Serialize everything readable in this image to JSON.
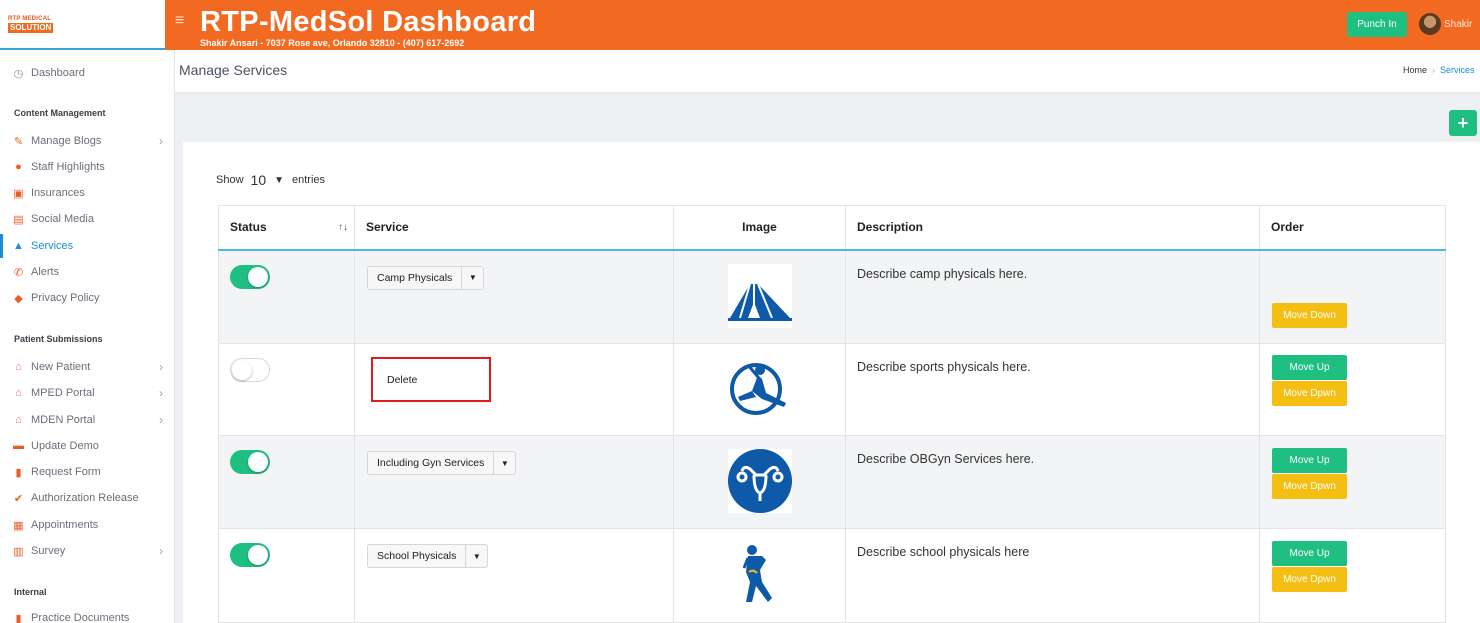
{
  "brand": {
    "logo_line1": "RTP MEDICAL",
    "logo_line2": "SOLUTION"
  },
  "header": {
    "title": "RTP-MedSol Dashboard",
    "subtitle": "Shakir Ansari - 7037 Rose ave, Orlando 32810 - (407) 617-2692",
    "punch_label": "Punch In",
    "user_name": "Shakir"
  },
  "sidebar": {
    "dashboard": "Dashboard",
    "sections": [
      "Content Management",
      "Patient Submissions",
      "Internal"
    ],
    "content_items": [
      {
        "label": "Manage Blogs",
        "icon": "blog-icon"
      },
      {
        "label": "Staff Highlights",
        "icon": "user-icon"
      },
      {
        "label": "Insurances",
        "icon": "building-icon"
      },
      {
        "label": "Social Media",
        "icon": "social-icon"
      },
      {
        "label": "Services",
        "icon": "services-icon"
      },
      {
        "label": "Alerts",
        "icon": "phone-icon"
      },
      {
        "label": "Privacy Policy",
        "icon": "shield-icon"
      }
    ],
    "patient_items": [
      {
        "label": "New Patient",
        "icon": "home-icon"
      },
      {
        "label": "MPED Portal",
        "icon": "home-icon"
      },
      {
        "label": "MDEN Portal",
        "icon": "home-icon"
      },
      {
        "label": "Update Demo",
        "icon": "id-card-icon"
      },
      {
        "label": "Request Form",
        "icon": "file-icon"
      },
      {
        "label": "Authorization Release",
        "icon": "check-file-icon"
      },
      {
        "label": "Appointments",
        "icon": "calendar-icon"
      },
      {
        "label": "Survey",
        "icon": "chart-icon"
      }
    ],
    "internal_items": [
      {
        "label": "Practice Documents",
        "icon": "doc-icon"
      }
    ]
  },
  "page": {
    "title": "Manage Services",
    "breadcrumb": [
      "Home",
      "Services"
    ],
    "add_label": "+"
  },
  "table": {
    "show_label": "Show",
    "entries_value": "10",
    "entries_label": "entries",
    "columns": [
      "Status",
      "Service",
      "Image",
      "Description",
      "Order"
    ],
    "rows": [
      {
        "status_on": true,
        "service": "Camp Physicals",
        "description": "Describe camp physicals here.",
        "image_icon": "tent-icon",
        "up": "",
        "down": "Move Down"
      },
      {
        "status_on": false,
        "service": "Delete",
        "description": "Describe sports physicals here.",
        "image_icon": "gymnast-icon",
        "up": "Move Up",
        "down": "Move Dpwn"
      },
      {
        "status_on": true,
        "service": "Including Gyn Services",
        "description": "Describe OBGyn Services here.",
        "image_icon": "uterus-icon",
        "up": "Move Up",
        "down": "Move Dpwn"
      },
      {
        "status_on": true,
        "service": "School Physicals",
        "description": "Describe school physicals here",
        "image_icon": "stretching-person-icon",
        "up": "Move Up",
        "down": "Move Dpwn"
      }
    ]
  },
  "colors": {
    "accent": "#f26a21",
    "green": "#1fbf82",
    "yellow": "#f5be12",
    "blue": "#1a8fd6",
    "icon_blue": "#0f5aa8"
  }
}
